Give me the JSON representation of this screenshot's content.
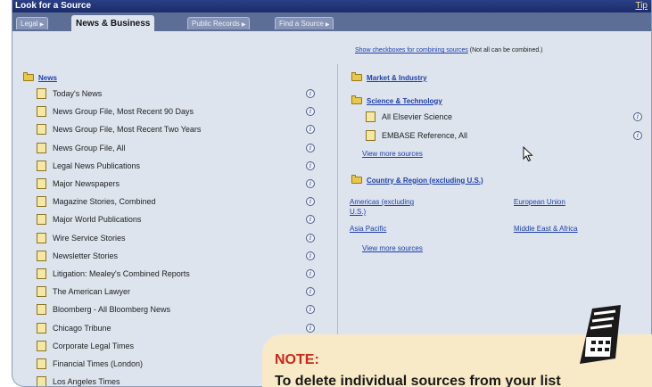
{
  "window": {
    "title": "Look for a Source",
    "help_link": "Tip"
  },
  "tabs": [
    {
      "label": "Legal"
    },
    {
      "label": "News & Business"
    },
    {
      "label": "Public Records"
    },
    {
      "label": "Find a Source"
    }
  ],
  "instruction": {
    "link": "Show checkboxes for combining sources",
    "note": "(Not all can be combined.)"
  },
  "left": {
    "category": "News",
    "sources": [
      "Today's News",
      "News Group File, Most Recent 90 Days",
      "News Group File, Most Recent Two Years",
      "News Group File, All",
      "Legal News Publications",
      "Major Newspapers",
      "Magazine Stories, Combined",
      "Major World Publications",
      "Wire Service Stories",
      "Newsletter Stories",
      "Litigation: Mealey's Combined Reports",
      "The American Lawyer",
      "Bloomberg - All Bloomberg News",
      "Chicago Tribune",
      "Corporate Legal Times",
      "Financial Times (London)",
      "Los Angeles Times"
    ]
  },
  "right": {
    "market": "Market & Industry",
    "science": {
      "title": "Science & Technology",
      "sources": [
        "All Elsevier Science",
        "EMBASE Reference, All"
      ],
      "more": "View more sources"
    },
    "country": {
      "title": "Country & Region (excluding U.S.)",
      "regions": [
        "Americas (excluding U.S.)",
        "European Union",
        "Asia Pacific",
        "Middle East & Africa"
      ],
      "more": "View more sources"
    }
  },
  "note": {
    "heading": "NOTE:",
    "text": "To delete individual sources from your list"
  },
  "colors": {
    "titlebar": "#1c2c6a",
    "panel": "#dde4ee",
    "link": "#1f3ea8",
    "note_bg": "#f8eac6",
    "note_head": "#c8281c"
  }
}
